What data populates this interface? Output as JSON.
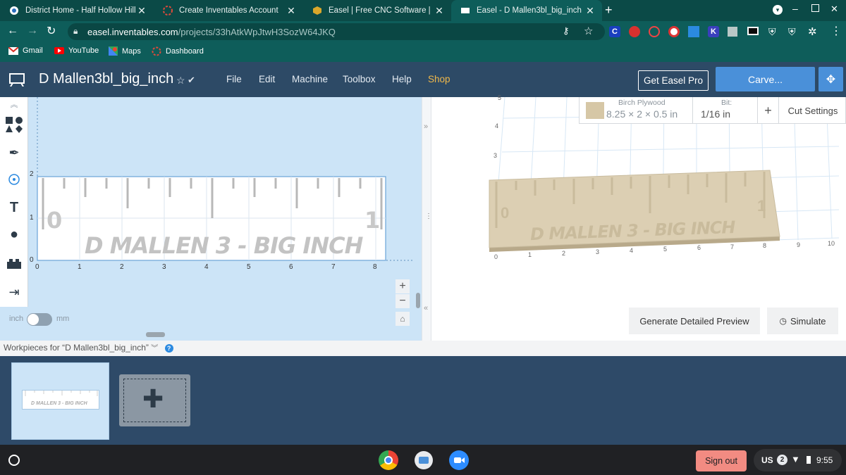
{
  "browser": {
    "tabs": [
      {
        "title": "District Home - Half Hollow Hills",
        "icon": "district-favicon-icon"
      },
      {
        "title": "Create Inventables Account",
        "icon": "inventables-favicon-icon"
      },
      {
        "title": "Easel | Free CNC Software | Inven",
        "icon": "easel-favicon-icon"
      },
      {
        "title": "Easel - D Mallen3bl_big_inch",
        "icon": "easel-active-favicon-icon",
        "active": true
      }
    ],
    "url_host": "easel.inventables.com",
    "url_path": "/projects/33hAtkWpJtwH3SozW64JKQ",
    "bookmarks": [
      {
        "label": "Gmail",
        "icon": "gmail-icon"
      },
      {
        "label": "YouTube",
        "icon": "youtube-icon"
      },
      {
        "label": "Maps",
        "icon": "maps-icon"
      },
      {
        "label": "Dashboard",
        "icon": "dashboard-icon"
      }
    ],
    "extensions": [
      "C",
      "K"
    ]
  },
  "app": {
    "project_title": "D Mallen3bl_big_inch",
    "menu": [
      "File",
      "Edit",
      "Machine",
      "Toolbox",
      "Help",
      "Shop"
    ],
    "get_pro_label": "Get Easel Pro",
    "carve_label": "Carve...",
    "accent_shop": "#f0b84a",
    "carve_color": "#4a90d9"
  },
  "design": {
    "ruler_text": "D MALLEN 3 - BIG INCH",
    "zero_label": "0",
    "one_label": "1",
    "x_ticks": [
      "0",
      "1",
      "2",
      "3",
      "4",
      "5",
      "6",
      "7",
      "8"
    ],
    "y_ticks": [
      "2",
      "1",
      "0"
    ],
    "unit_inch": "inch",
    "unit_mm": "mm"
  },
  "material": {
    "name": "Birch Plywood",
    "dims": "8.25 × 2 × 0.5 in",
    "bit_label": "Bit:",
    "bit_value": "1/16 in",
    "plus": "+",
    "cut_settings": "Cut Settings"
  },
  "preview": {
    "ruler_text": "D MALLEN 3 - BIG INCH",
    "x_ticks": [
      "0",
      "1",
      "2",
      "3",
      "4",
      "5",
      "6",
      "7",
      "8",
      "9",
      "10"
    ],
    "y_ticks": [
      "5",
      "4",
      "3"
    ],
    "zero_label": "0",
    "one_label": "1",
    "generate_label": "Generate Detailed Preview",
    "simulate_label": "Simulate"
  },
  "workpieces": {
    "label": "Workpieces for “D Mallen3bl_big_inch”",
    "thumb_text": "D MALLEN 3 - BIG INCH"
  },
  "shelf": {
    "sign_out": "Sign out",
    "locale": "US",
    "notif_count": "2",
    "time": "9:55"
  }
}
